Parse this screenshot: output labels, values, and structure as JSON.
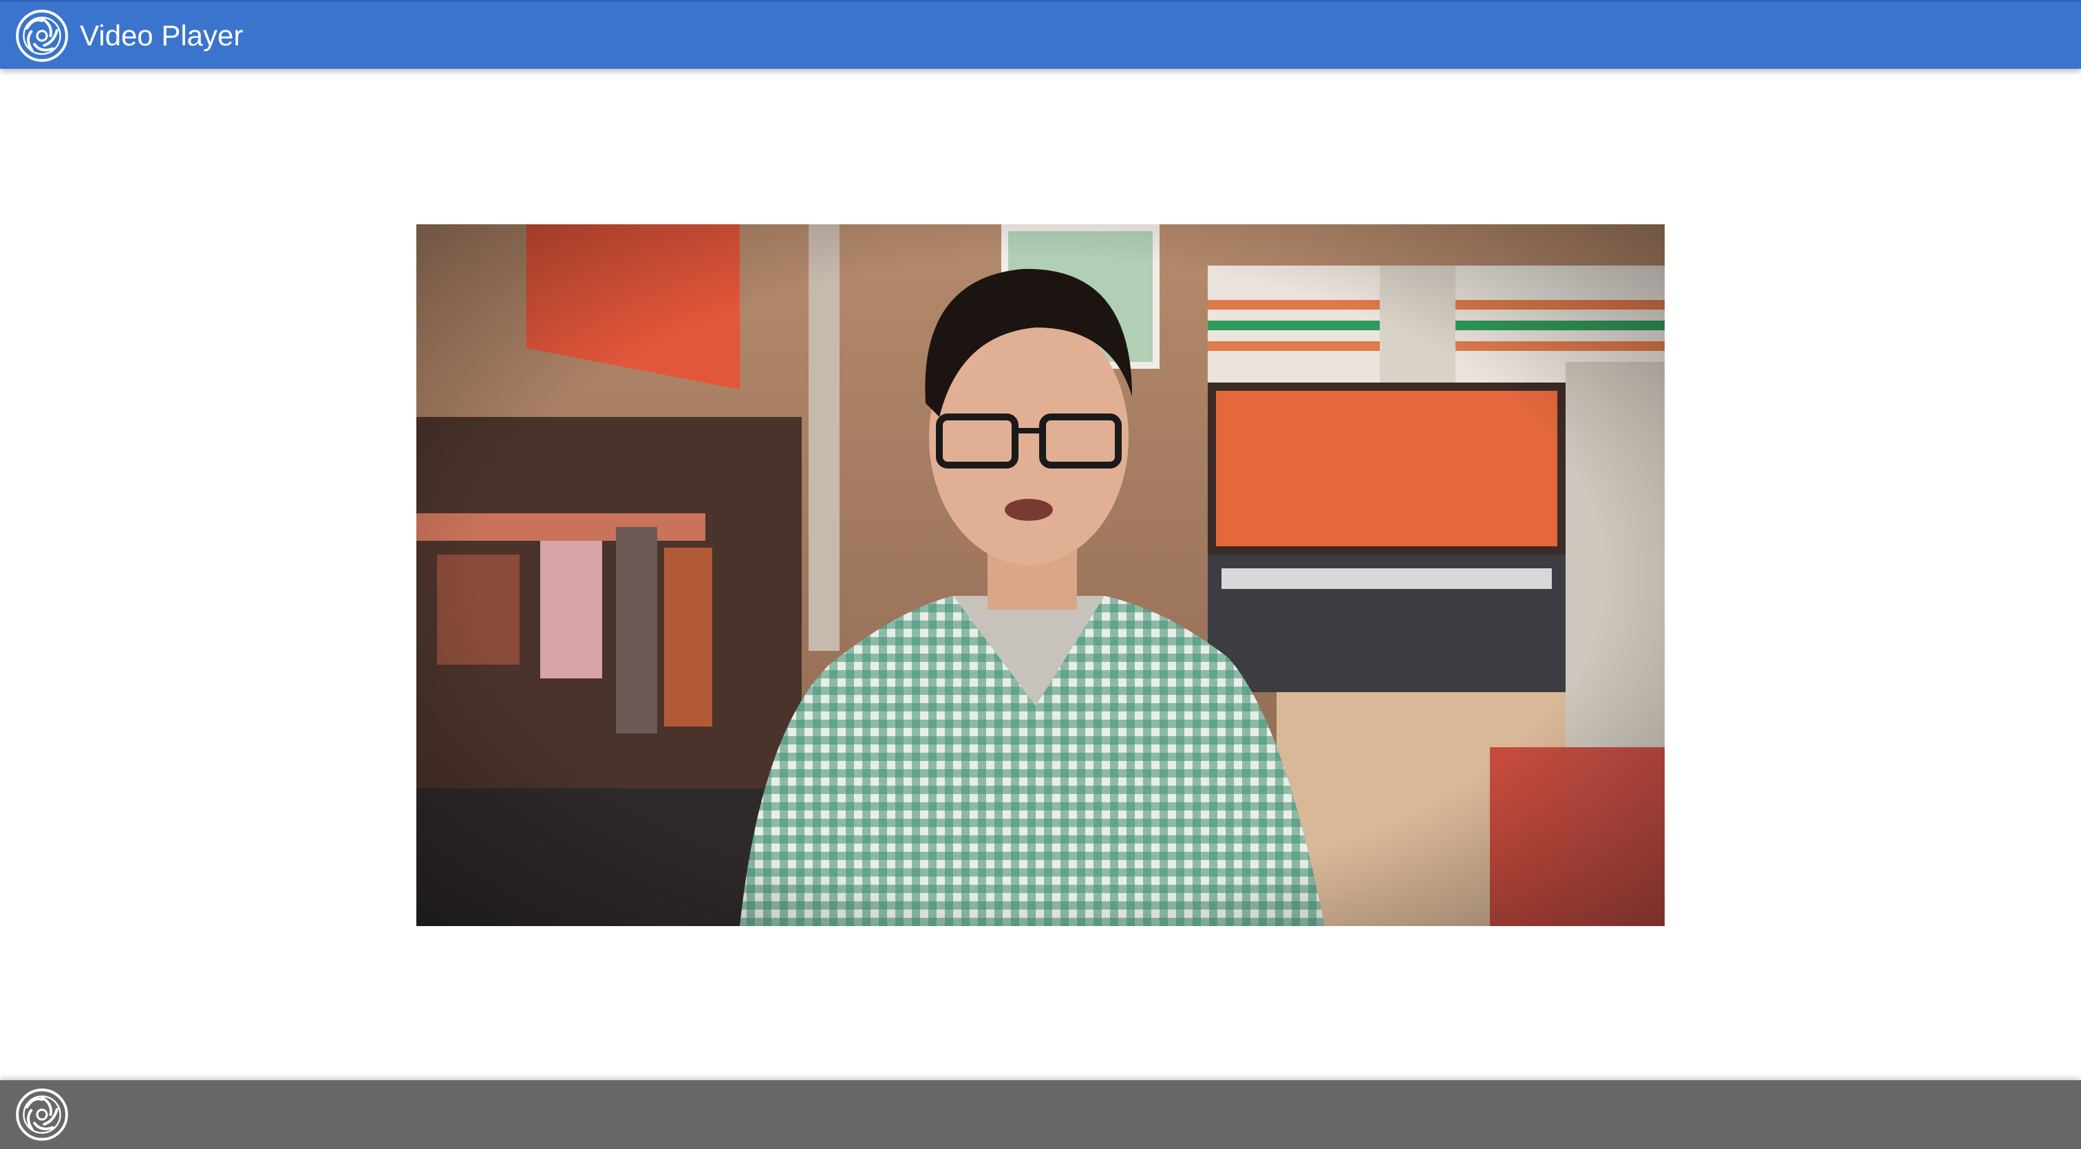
{
  "app": {
    "title": "Video Player",
    "logo_icon": "aperture-logo-icon"
  },
  "colors": {
    "header_bg": "#3a74cd",
    "footer_bg": "#676767",
    "page_bg": "#ffffff"
  },
  "video": {
    "description_icon": "video-frame"
  },
  "footer": {
    "logo_icon": "aperture-logo-icon"
  }
}
